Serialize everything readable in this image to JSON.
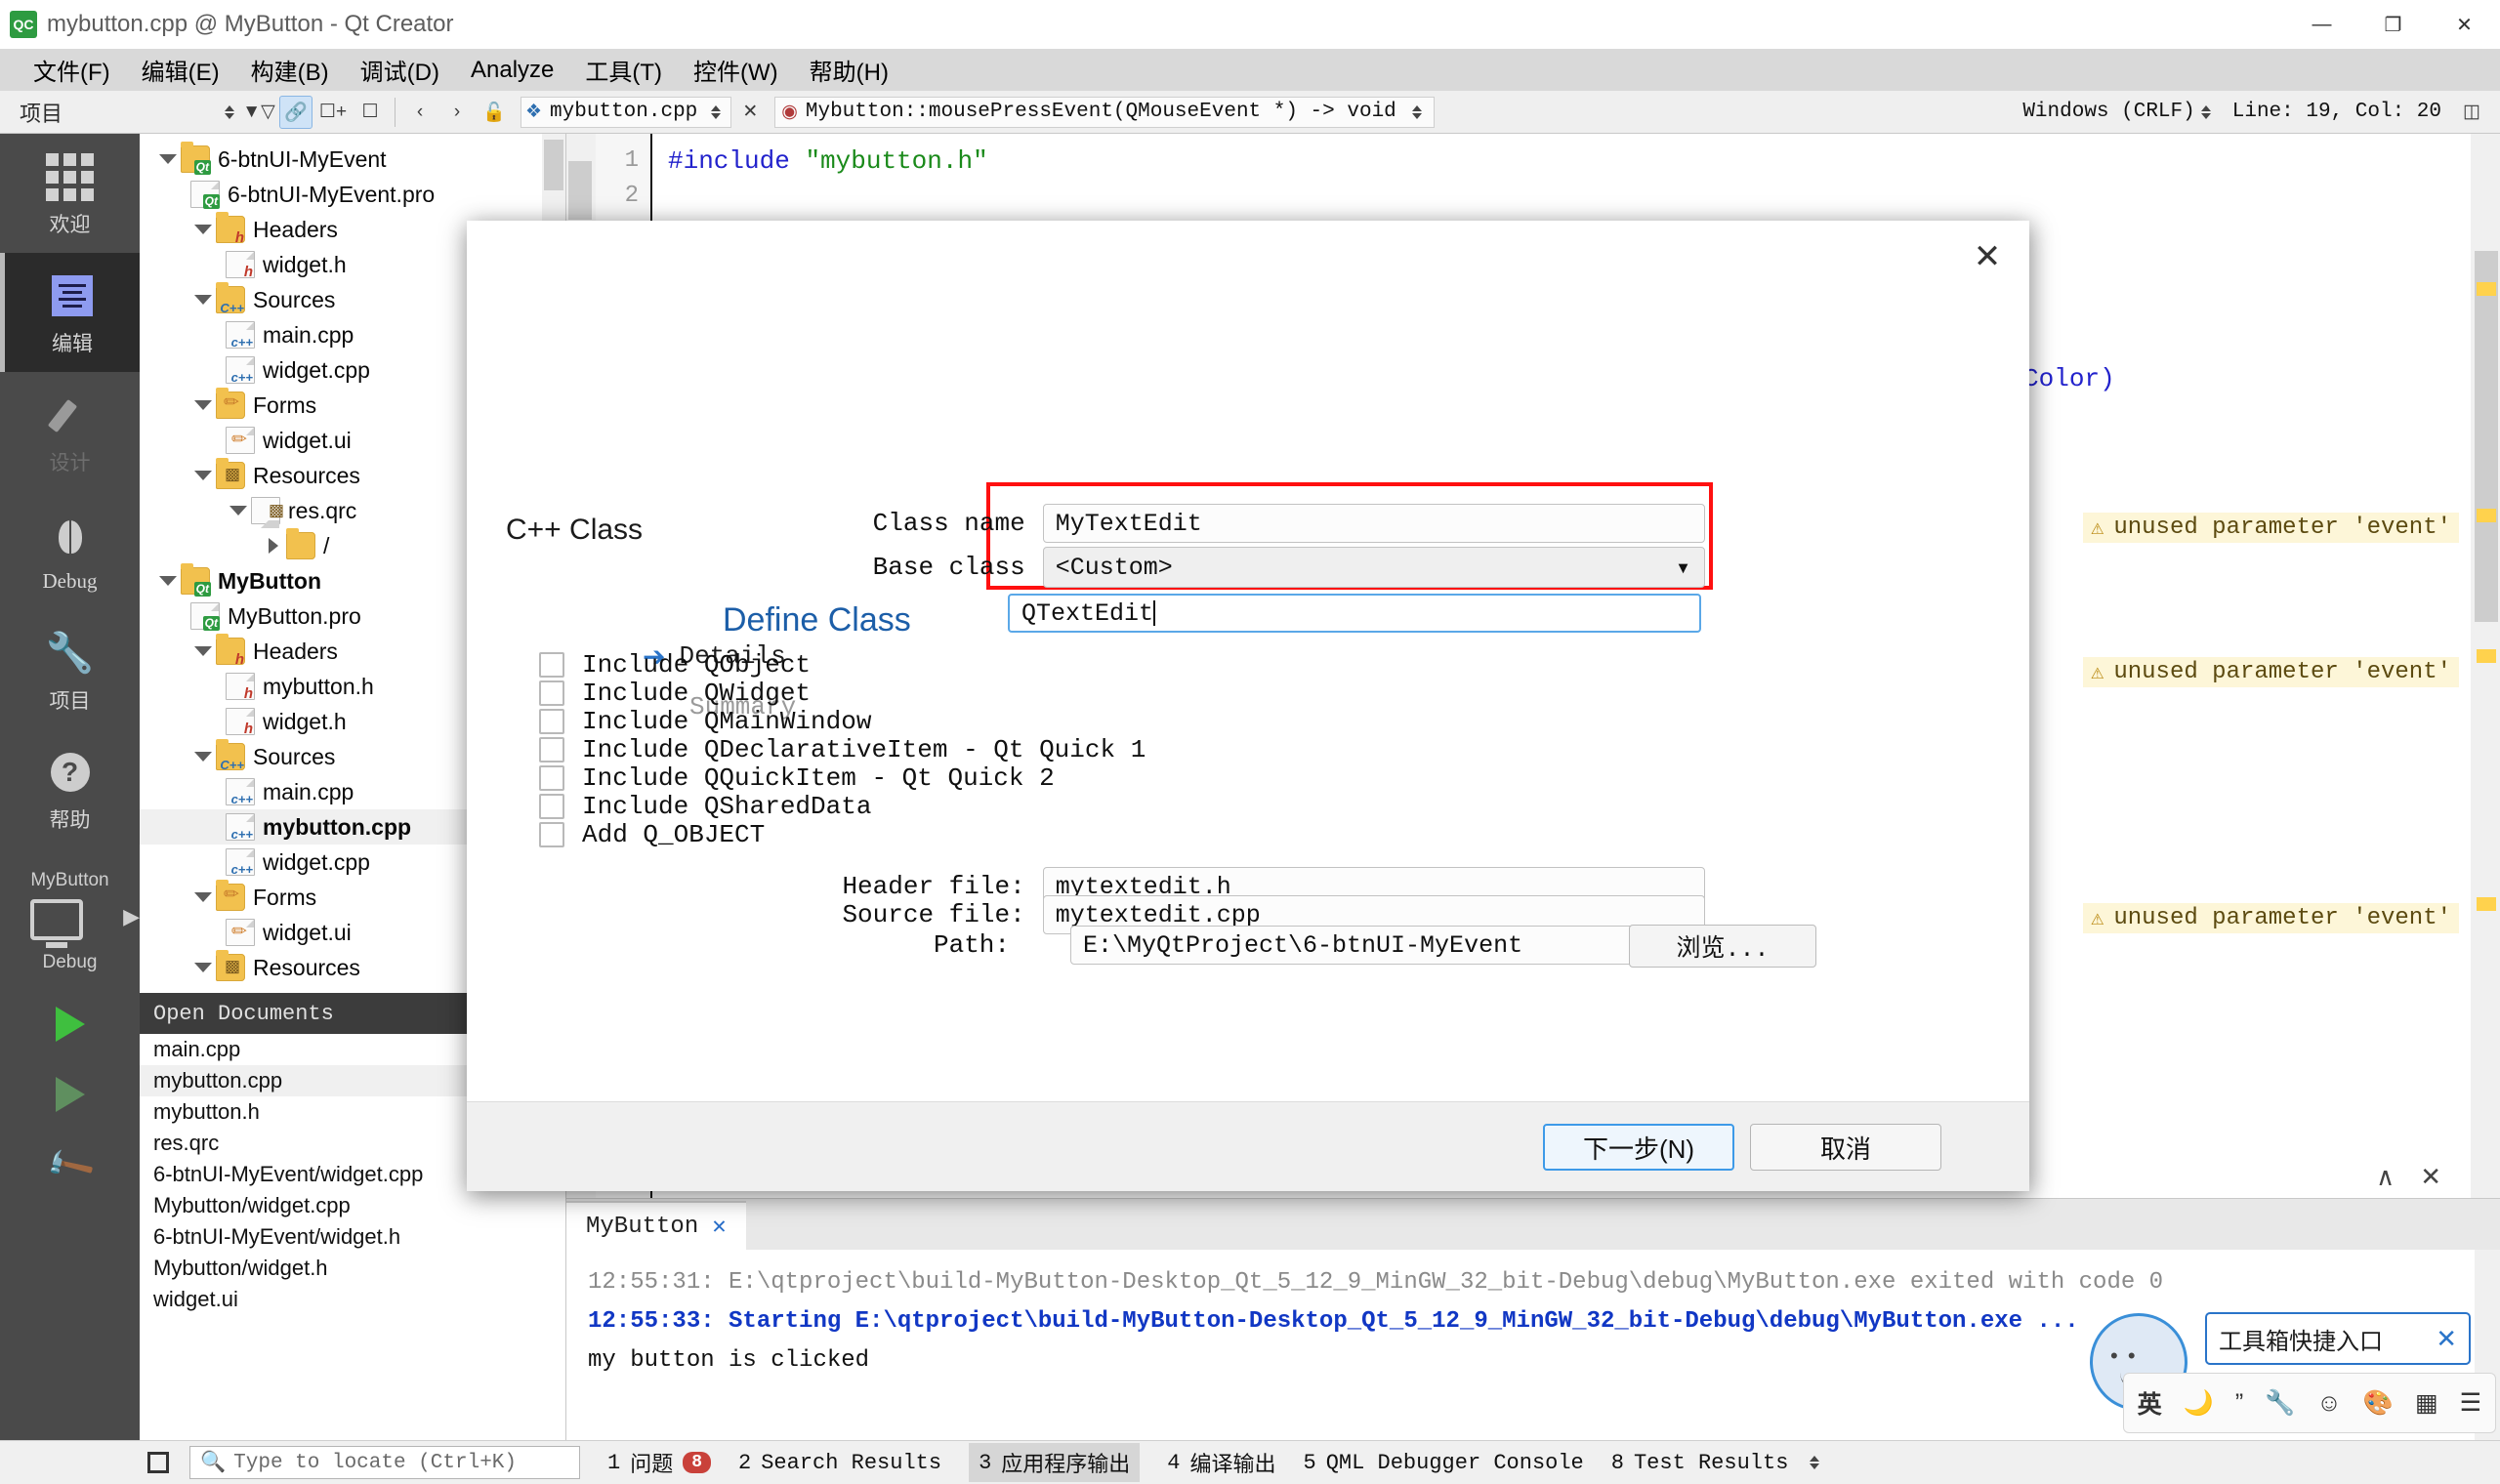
{
  "window": {
    "title": "mybutton.cpp @ MyButton - Qt Creator",
    "logo_text": "QC",
    "minimize": "—",
    "maximize": "❐",
    "close": "✕"
  },
  "menubar": {
    "items": [
      {
        "label": "文件(F)",
        "accel": "F"
      },
      {
        "label": "编辑(E)",
        "accel": "E"
      },
      {
        "label": "构建(B)",
        "accel": "B"
      },
      {
        "label": "调试(D)",
        "accel": "D"
      },
      {
        "label": "Analyze",
        "accel": "A"
      },
      {
        "label": "工具(T)",
        "accel": "T"
      },
      {
        "label": "控件(W)",
        "accel": "W"
      },
      {
        "label": "帮助(H)",
        "accel": "H"
      }
    ]
  },
  "toolbar": {
    "projects_label": "项目",
    "filter_icon": "filter-icon",
    "link_icon": "link-icon",
    "split_icon": "split-icon",
    "close_split_icon": "close-split-icon",
    "back_icon": "‹",
    "forward_icon": "›",
    "lock_icon": "lock-icon",
    "current_file": "mybutton.cpp",
    "current_symbol": "Mybutton::mousePressEvent(QMouseEvent *) -> void",
    "line_ending": "Windows (CRLF)",
    "cursor_position": "Line: 19, Col: 20",
    "split_right_icon": "split-right-icon"
  },
  "modebar": {
    "items": [
      {
        "label": "欢迎",
        "icon": "grid-icon",
        "selected": false
      },
      {
        "label": "编辑",
        "icon": "edit-icon",
        "selected": true
      },
      {
        "label": "设计",
        "icon": "pencil-icon",
        "selected": false,
        "disabled": true
      },
      {
        "label": "Debug",
        "icon": "bug-icon",
        "selected": false
      },
      {
        "label": "项目",
        "icon": "wrench-icon",
        "selected": false
      },
      {
        "label": "帮助",
        "icon": "question-icon",
        "selected": false
      }
    ],
    "kit": {
      "project": "MyButton",
      "build_config": "Debug",
      "monitor_icon": "monitor-icon",
      "chevron_icon": "chevron-right-icon"
    },
    "run_icon": "run-triangle-icon",
    "debug_run_icon": "debug-run-icon",
    "build_icon": "hammer-icon"
  },
  "project_tree": {
    "header": "项目",
    "rows": [
      {
        "label": "6-btnUI-MyEvent",
        "indent": 1,
        "twist": "down",
        "icon": "folder-qt",
        "bold": false
      },
      {
        "label": "6-btnUI-MyEvent.pro",
        "indent": 2,
        "twist": "none",
        "icon": "doc-qt",
        "bold": false
      },
      {
        "label": "Headers",
        "indent": 2,
        "twist": "down",
        "icon": "folder-h",
        "bold": false
      },
      {
        "label": "widget.h",
        "indent": 3,
        "twist": "none",
        "icon": "doc-h",
        "bold": false
      },
      {
        "label": "Sources",
        "indent": 2,
        "twist": "down",
        "icon": "folder-cpp",
        "bold": false
      },
      {
        "label": "main.cpp",
        "indent": 3,
        "twist": "none",
        "icon": "doc-cpp",
        "bold": false
      },
      {
        "label": "widget.cpp",
        "indent": 3,
        "twist": "none",
        "icon": "doc-cpp",
        "bold": false
      },
      {
        "label": "Forms",
        "indent": 2,
        "twist": "down",
        "icon": "folder-form",
        "bold": false
      },
      {
        "label": "widget.ui",
        "indent": 3,
        "twist": "none",
        "icon": "doc-form",
        "bold": false
      },
      {
        "label": "Resources",
        "indent": 2,
        "twist": "down",
        "icon": "folder-res",
        "bold": false
      },
      {
        "label": "res.qrc",
        "indent": 3,
        "twist": "down",
        "icon": "doc-res",
        "bold": false
      },
      {
        "label": "/",
        "indent": 4,
        "twist": "right",
        "icon": "folder",
        "bold": false
      },
      {
        "label": "MyButton",
        "indent": 1,
        "twist": "down",
        "icon": "folder-qt",
        "bold": true
      },
      {
        "label": "MyButton.pro",
        "indent": 2,
        "twist": "none",
        "icon": "doc-qt",
        "bold": false
      },
      {
        "label": "Headers",
        "indent": 2,
        "twist": "down",
        "icon": "folder-h",
        "bold": false
      },
      {
        "label": "mybutton.h",
        "indent": 3,
        "twist": "none",
        "icon": "doc-h",
        "bold": false
      },
      {
        "label": "widget.h",
        "indent": 3,
        "twist": "none",
        "icon": "doc-h",
        "bold": false
      },
      {
        "label": "Sources",
        "indent": 2,
        "twist": "down",
        "icon": "folder-cpp",
        "bold": false
      },
      {
        "label": "main.cpp",
        "indent": 3,
        "twist": "none",
        "icon": "doc-cpp",
        "bold": false
      },
      {
        "label": "mybutton.cpp",
        "indent": 3,
        "twist": "none",
        "icon": "doc-cpp",
        "bold": true,
        "selected": true
      },
      {
        "label": "widget.cpp",
        "indent": 3,
        "twist": "none",
        "icon": "doc-cpp",
        "bold": false
      },
      {
        "label": "Forms",
        "indent": 2,
        "twist": "down",
        "icon": "folder-form",
        "bold": false
      },
      {
        "label": "widget.ui",
        "indent": 3,
        "twist": "none",
        "icon": "doc-form",
        "bold": false
      },
      {
        "label": "Resources",
        "indent": 2,
        "twist": "down",
        "icon": "folder-res",
        "bold": false
      }
    ]
  },
  "open_documents": {
    "header": "Open Documents",
    "rows": [
      {
        "label": "main.cpp",
        "selected": false
      },
      {
        "label": "mybutton.cpp",
        "selected": true
      },
      {
        "label": "mybutton.h",
        "selected": false
      },
      {
        "label": "res.qrc",
        "selected": false
      },
      {
        "label": "6-btnUI-MyEvent/widget.cpp",
        "selected": false
      },
      {
        "label": "Mybutton/widget.cpp",
        "selected": false
      },
      {
        "label": "6-btnUI-MyEvent/widget.h",
        "selected": false
      },
      {
        "label": "Mybutton/widget.h",
        "selected": false
      },
      {
        "label": "widget.ui",
        "selected": false
      }
    ]
  },
  "editor": {
    "lines": [
      {
        "num": "1",
        "code": "#include \"mybutton.h\""
      },
      {
        "num": "2",
        "code": ""
      }
    ],
    "visible_code_right": "ags flags = Qt::AutoColor)",
    "warnings": [
      "unused parameter 'event'",
      "unused parameter 'event'",
      "unused parameter 'event'"
    ],
    "warning_icon": "warning-triangle-icon"
  },
  "dialog": {
    "kind": "C++ Class",
    "title": "Define Class",
    "close_icon": "✕",
    "steps": [
      {
        "label": "Details",
        "active": true
      },
      {
        "label": "Summary",
        "active": false
      }
    ],
    "fields": {
      "class_name_label": "Class name",
      "class_name_value": "MyTextEdit",
      "base_class_label": "Base class",
      "base_class_value": "<Custom>",
      "custom_base_value": "QTextEdit"
    },
    "checkboxes": [
      {
        "label": "Include QObject",
        "checked": false
      },
      {
        "label": "Include QWidget",
        "checked": false
      },
      {
        "label": "Include QMainWindow",
        "checked": false
      },
      {
        "label": "Include QDeclarativeItem - Qt Quick 1",
        "checked": false
      },
      {
        "label": "Include QQuickItem - Qt Quick 2",
        "checked": false
      },
      {
        "label": "Include QSharedData",
        "checked": false
      },
      {
        "label": "Add Q_OBJECT",
        "checked": false
      }
    ],
    "files": {
      "header_label": "Header file:",
      "header_value": "mytextedit.h",
      "source_label": "Source file:",
      "source_value": "mytextedit.cpp",
      "path_label": "Path:",
      "path_value": "E:\\MyQtProject\\6-btnUI-MyEvent",
      "browse_label": "浏览..."
    },
    "buttons": {
      "next": "下一步(N)",
      "cancel": "取消"
    },
    "highlight_color": "#ff1010"
  },
  "output": {
    "tab_label": "MyButton",
    "tab_close_icon": "✕",
    "lines": [
      {
        "text": "12:55:31: E:\\qtproject\\build-MyButton-Desktop_Qt_5_12_9_MinGW_32_bit-Debug\\debug\\MyButton.exe exited with code 0",
        "style": "gray"
      },
      {
        "text": "",
        "style": "gray"
      },
      {
        "text": "12:55:33: Starting E:\\qtproject\\build-MyButton-Desktop_Qt_5_12_9_MinGW_32_bit-Debug\\debug\\MyButton.exe ...",
        "style": "blue"
      },
      {
        "text": "my button is clicked",
        "style": "black"
      }
    ],
    "collapse_icon": "∧",
    "close_icon": "✕"
  },
  "statusbar": {
    "panel_icon": "panel-toggle-icon",
    "search_icon": "search-icon",
    "search_placeholder": "Type to locate (Ctrl+K)",
    "items": [
      {
        "num": "1",
        "label": "问题",
        "badge": "8"
      },
      {
        "num": "2",
        "label": "Search Results",
        "badge": ""
      },
      {
        "num": "3",
        "label": "应用程序输出",
        "badge": "",
        "selected": true
      },
      {
        "num": "4",
        "label": "编译输出",
        "badge": ""
      },
      {
        "num": "5",
        "label": "QML Debugger Console",
        "badge": ""
      },
      {
        "num": "8",
        "label": "Test Results",
        "badge": ""
      }
    ]
  },
  "ime": {
    "tooltip": "工具箱快捷入口",
    "tooltip_close": "✕",
    "mode": "英",
    "icons": [
      "moon-icon",
      "quote-icon",
      "wrench-icon",
      "smiley-icon",
      "palette-icon",
      "keyboard-icon",
      "menu-icon"
    ]
  }
}
